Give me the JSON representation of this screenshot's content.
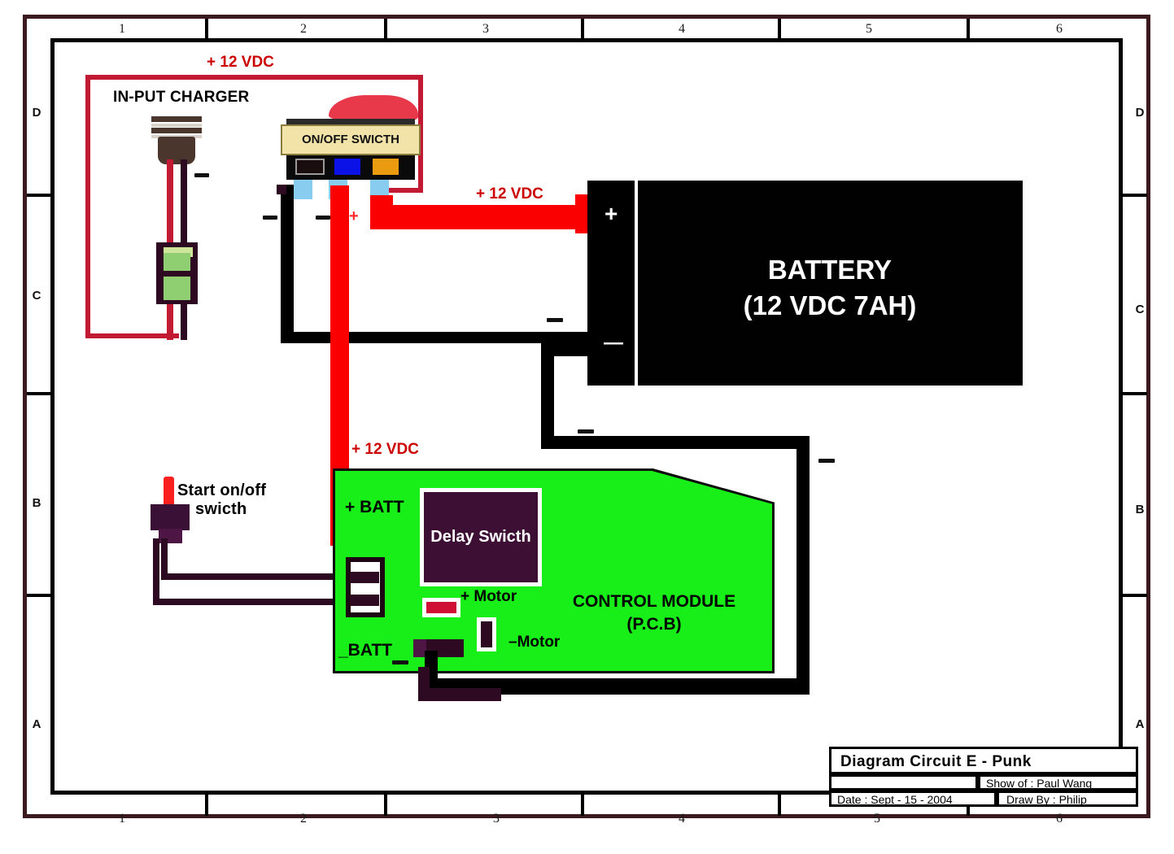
{
  "document": {
    "type": "electrical wiring diagram",
    "title_block": {
      "title": "Diagram Circuit  E - Punk",
      "blank_cell": "",
      "show_of": "Show of : Paul Wang",
      "date": "Date : Sept - 15 - 2004",
      "draw_by": "Draw By : Philip"
    },
    "frame": {
      "column_labels": [
        "1",
        "2",
        "3",
        "4",
        "5",
        "6"
      ],
      "row_labels_top_to_bottom": [
        "D",
        "C",
        "B",
        "A"
      ]
    }
  },
  "labels": {
    "charger_title": "IN-PUT CHARGER",
    "vdc_top": "+ 12 VDC",
    "vdc_battery": "+ 12 VDC",
    "vdc_module": "+ 12 VDC",
    "switch_face": "ON/OFF SWICTH",
    "start_switch": "Start on/off swicth",
    "start_switch_line1": "Start on/off",
    "start_switch_line2": "swicth",
    "plus_sign": "+",
    "minus_sign": "—"
  },
  "battery": {
    "name": "BATTERY",
    "spec": "(12 VDC 7AH)",
    "terminal_positive": "+",
    "terminal_negative": "—"
  },
  "control_module": {
    "name": "CONTROL MODULE",
    "subtitle": "(P.C.B)",
    "delay_switch": "Delay Swicth",
    "terminal_batt_plus": "+ BATT",
    "terminal_batt_minus": "_BATT",
    "terminal_motor_plus": "+ Motor",
    "terminal_motor_minus": "–Motor"
  },
  "colors": {
    "wire_positive": "#fb0000",
    "wire_charger_loop": "#c21a32",
    "wire_negative": "#000000",
    "wire_signal": "#2d0a22",
    "pcb_green": "#18ee18",
    "battery_black": "#010101",
    "switch_face": "#f2e3a8",
    "delay_switch": "#3d0f35",
    "label_red": "#cc0000"
  }
}
